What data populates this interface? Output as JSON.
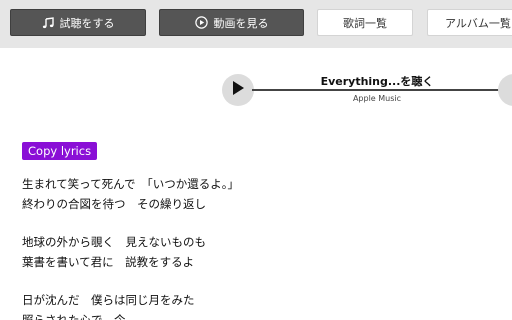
{
  "toolbar": {
    "listen_label": "試聴をする",
    "video_label": "動画を見る",
    "lyrics_list_label": "歌詞一覧",
    "album_list_label": "アルバム一覧"
  },
  "player": {
    "title": "Everything...を聴く",
    "source": "Apple Music"
  },
  "copy_button_label": "Copy lyrics",
  "lyrics": {
    "stanza1": [
      "生まれて笑って死んで　「いつか還るよ。」",
      "終わりの合図を待つ　その繰り返し"
    ],
    "stanza2": [
      "地球の外から覗く　見えないものも",
      "葉書を書いて君に　説教をするよ"
    ],
    "stanza3": [
      "日が沈んだ　僕らは同じ月をみた",
      "照らされた心で　今"
    ]
  },
  "colors": {
    "toolbar_bg": "#e6e6e6",
    "dark_button": "#555555",
    "copy_button": "#8a0fd6"
  },
  "icons": {
    "listen": "music-note-icon",
    "video": "play-circle-icon",
    "player_play": "play-icon"
  }
}
